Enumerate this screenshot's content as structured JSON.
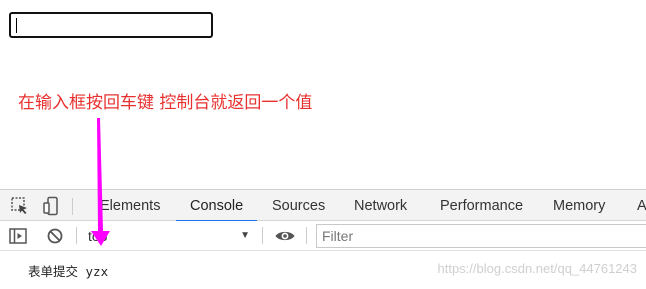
{
  "page": {
    "input_value": "",
    "annotation": "在输入框按回车键 控制台就返回一个值"
  },
  "devtools": {
    "tabs": [
      {
        "label": "Elements",
        "active": false
      },
      {
        "label": "Console",
        "active": true
      },
      {
        "label": "Sources",
        "active": false
      },
      {
        "label": "Network",
        "active": false
      },
      {
        "label": "Performance",
        "active": false
      },
      {
        "label": "Memory",
        "active": false
      },
      {
        "label": "A",
        "active": false
      }
    ],
    "context": "top",
    "filter_placeholder": "Filter",
    "console_output": "表单提交 yzx",
    "watermark": "https://blog.csdn.net/qq_44761243"
  },
  "colors": {
    "annotation": "#e8312f",
    "arrow": "#ff00ff",
    "active_tab_underline": "#1a73e8"
  },
  "icons": [
    "inspect-element-icon",
    "device-toolbar-icon",
    "sidebar-toggle-icon",
    "clear-console-icon",
    "dropdown-arrow-icon",
    "live-expression-eye-icon"
  ]
}
